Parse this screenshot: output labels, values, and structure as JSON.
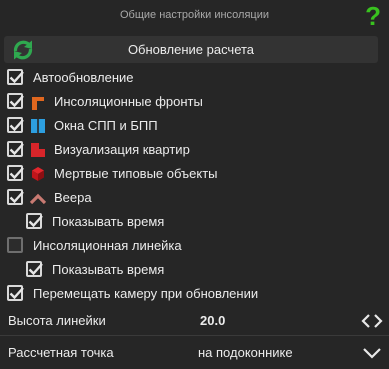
{
  "header": {
    "title": "Общие настройки инсоляции",
    "help_label": "?"
  },
  "update_button": {
    "label": "Обновление расчета",
    "icon": "refresh-icon",
    "color": "#2fa84f"
  },
  "options": [
    {
      "id": "auto-update",
      "label": "Автообновление",
      "checked": true,
      "icon": null,
      "indent": 0
    },
    {
      "id": "insolation-fronts",
      "label": "Инсоляционные фронты",
      "checked": true,
      "icon": "front-icon",
      "icon_color": "#e0671f",
      "indent": 0
    },
    {
      "id": "spp-windows",
      "label": "Окна СПП и БПП",
      "checked": true,
      "icon": "window-icon",
      "icon_color": "#2d9fe0",
      "indent": 0
    },
    {
      "id": "apartment-vis",
      "label": "Визуализация квартир",
      "checked": true,
      "icon": "apartment-icon",
      "icon_color": "#d8252a",
      "indent": 0
    },
    {
      "id": "dead-objects",
      "label": "Мертвые типовые объекты",
      "checked": true,
      "icon": "cube-icon",
      "icon_color": "#c0151b",
      "indent": 0
    },
    {
      "id": "fans",
      "label": "Веера",
      "checked": true,
      "icon": "fan-icon",
      "icon_color": "#c87a72",
      "indent": 0
    },
    {
      "id": "fans-show-time",
      "label": "Показывать время",
      "checked": true,
      "icon": null,
      "indent": 1
    },
    {
      "id": "insolation-ruler",
      "label": "Инсоляционная линейка",
      "checked": false,
      "icon": null,
      "indent": 0
    },
    {
      "id": "ruler-show-time",
      "label": "Показывать время",
      "checked": true,
      "icon": null,
      "indent": 1
    },
    {
      "id": "move-camera",
      "label": "Перемещать камеру при обновлении",
      "checked": true,
      "icon": null,
      "indent": 0
    }
  ],
  "ruler_height": {
    "label": "Высота линейки",
    "value": "20.0"
  },
  "calc_point": {
    "label": "Рассчетная точка",
    "value": "на подоконнике"
  }
}
